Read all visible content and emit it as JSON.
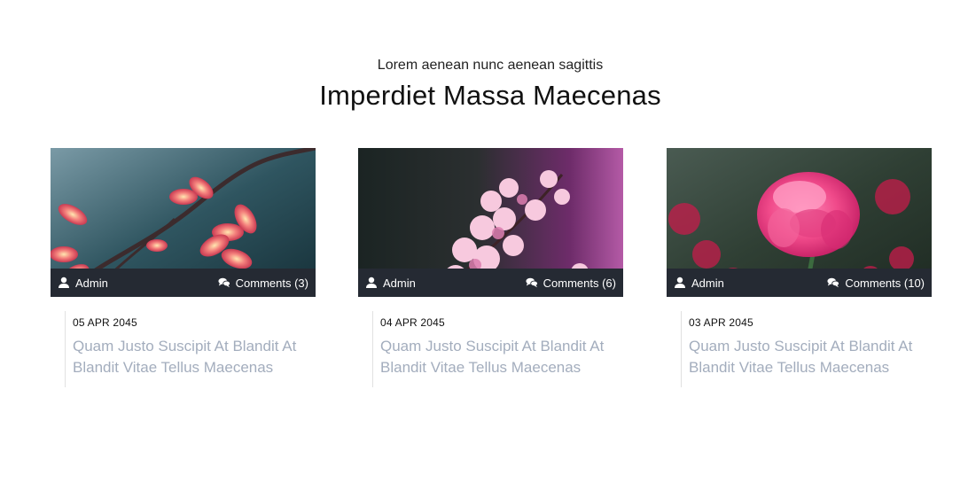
{
  "section": {
    "subtitle": "Lorem aenean nunc aenean sagittis",
    "title": "Imperdiet Massa Maecenas"
  },
  "cards": [
    {
      "author": "Admin",
      "comments": "Comments (3)",
      "date": "05 APR 2045",
      "title": "Quam Justo Suscipit At Blandit At Blandit Vitae Tellus Maecenas"
    },
    {
      "author": "Admin",
      "comments": "Comments (6)",
      "date": "04 APR 2045",
      "title": "Quam Justo Suscipit At Blandit At Blandit Vitae Tellus Maecenas"
    },
    {
      "author": "Admin",
      "comments": "Comments (10)",
      "date": "03 APR 2045",
      "title": "Quam Justo Suscipit At Blandit At Blandit Vitae Tellus Maecenas"
    }
  ],
  "icons": {
    "author": "user-icon",
    "comments": "comments-icon"
  },
  "colors": {
    "meta_bar": "#252a33",
    "post_title": "#a3adbd"
  }
}
